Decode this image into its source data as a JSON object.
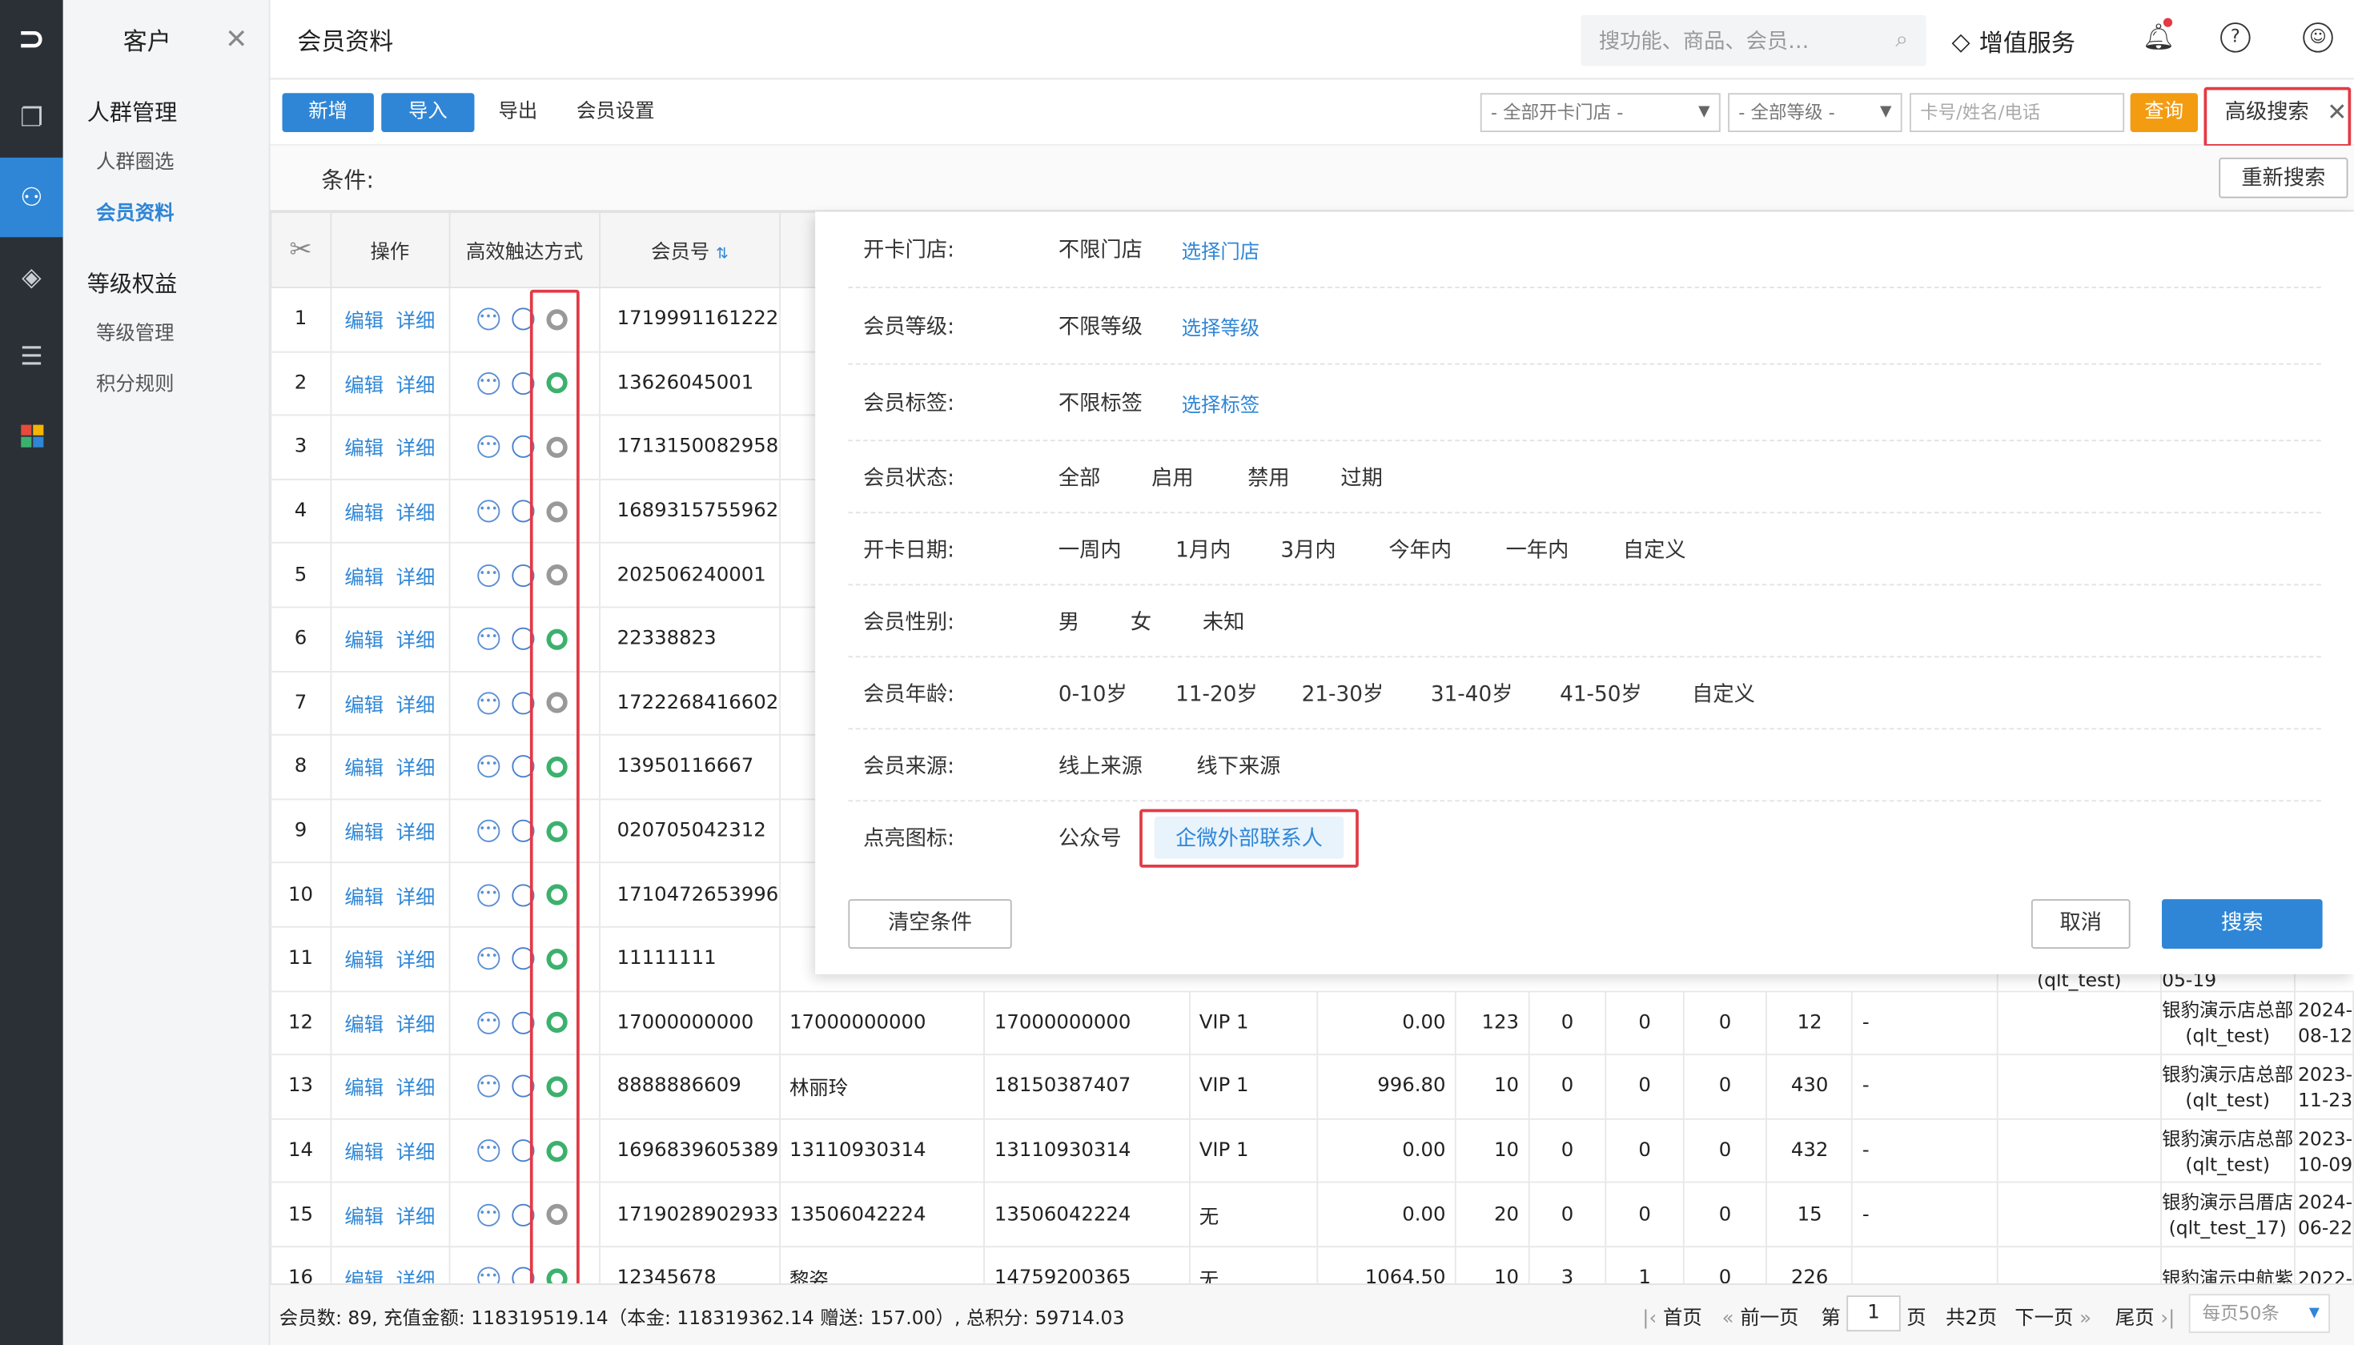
{
  "sidebar": {
    "module": "客户",
    "groups": [
      {
        "title": "人群管理",
        "items": [
          "人群圈选",
          "会员资料"
        ]
      },
      {
        "title": "等级权益",
        "items": [
          "等级管理",
          "积分规则"
        ]
      }
    ]
  },
  "header": {
    "title": "会员资料",
    "search_placeholder": "搜功能、商品、会员…",
    "value_service": "增值服务"
  },
  "toolbar": {
    "add": "新增",
    "import": "导入",
    "export": "导出",
    "settings": "会员设置",
    "store_select": "- 全部开卡门店 -",
    "level_select": "- 全部等级 -",
    "keyword_placeholder": "卡号/姓名/电话",
    "query": "查询",
    "advanced": "高级搜索"
  },
  "condition": {
    "label": "条件:",
    "reset": "重新搜索"
  },
  "table": {
    "headers": [
      "操作",
      "高效触达方式",
      "会员号"
    ],
    "edit": "编辑",
    "detail": "详细",
    "rows": [
      {
        "no": "1",
        "id": "1719991161222",
        "green": false
      },
      {
        "no": "2",
        "id": "13626045001",
        "green": true
      },
      {
        "no": "3",
        "id": "1713150082958",
        "green": false
      },
      {
        "no": "4",
        "id": "1689315755962",
        "green": false
      },
      {
        "no": "5",
        "id": "202506240001",
        "green": false
      },
      {
        "no": "6",
        "id": "22338823",
        "green": true
      },
      {
        "no": "7",
        "id": "1722268416602",
        "green": false
      },
      {
        "no": "8",
        "id": "13950116667",
        "green": true
      },
      {
        "no": "9",
        "id": "020705042312",
        "green": true
      },
      {
        "no": "10",
        "id": "1710472653996",
        "green": true
      },
      {
        "no": "11",
        "id": "11111111",
        "green": true
      },
      {
        "no": "12",
        "id": "17000000000",
        "green": true,
        "name": "17000000000",
        "phone": "17000000000",
        "level": "VIP 1",
        "amount": "0.00",
        "points": "123",
        "c1": "0",
        "c2": "0",
        "c3": "0",
        "visits": "12",
        "dash": "-",
        "store": "银豹演示店总部",
        "store2": "(qlt_test)",
        "date": "2024-",
        "date2": "08-12"
      },
      {
        "no": "13",
        "id": "8888886609",
        "green": true,
        "name": "林丽玲",
        "phone": "18150387407",
        "level": "VIP 1",
        "amount": "996.80",
        "points": "10",
        "c1": "0",
        "c2": "0",
        "c3": "0",
        "visits": "430",
        "dash": "-",
        "store": "银豹演示店总部",
        "store2": "(qlt_test)",
        "date": "2023-",
        "date2": "11-23"
      },
      {
        "no": "14",
        "id": "1696839605389",
        "green": true,
        "name": "13110930314",
        "phone": "13110930314",
        "level": "VIP 1",
        "amount": "0.00",
        "points": "10",
        "c1": "0",
        "c2": "0",
        "c3": "0",
        "visits": "432",
        "dash": "-",
        "store": "银豹演示店总部",
        "store2": "(qlt_test)",
        "date": "2023-",
        "date2": "10-09"
      },
      {
        "no": "15",
        "id": "1719028902933",
        "green": false,
        "name": "13506042224",
        "phone": "13506042224",
        "level": "无",
        "amount": "0.00",
        "points": "20",
        "c1": "0",
        "c2": "0",
        "c3": "0",
        "visits": "15",
        "dash": "-",
        "store": "银豹演示吕厝店",
        "store2": "(qlt_test_17)",
        "date": "2024-",
        "date2": "06-22"
      },
      {
        "no": "16",
        "id": "12345678",
        "green": true,
        "name": "黎姿",
        "phone": "14759200365",
        "level": "无",
        "amount": "1064.50",
        "points": "10",
        "c1": "3",
        "c2": "1",
        "c3": "0",
        "visits": "226",
        "dash": "",
        "store": "银豹演示中航紫",
        "store2": "",
        "date": "2022-",
        "date2": ""
      }
    ],
    "row11_store2": "(qlt_test)",
    "row11_date": "05-19"
  },
  "panel": {
    "store": {
      "label": "开卡门店:",
      "value": "不限门店",
      "link": "选择门店"
    },
    "level": {
      "label": "会员等级:",
      "value": "不限等级",
      "link": "选择等级"
    },
    "tag": {
      "label": "会员标签:",
      "value": "不限标签",
      "link": "选择标签"
    },
    "status": {
      "label": "会员状态:",
      "options": [
        "全部",
        "启用",
        "禁用",
        "过期"
      ]
    },
    "date": {
      "label": "开卡日期:",
      "options": [
        "一周内",
        "1月内",
        "3月内",
        "今年内",
        "一年内",
        "自定义"
      ]
    },
    "gender": {
      "label": "会员性别:",
      "options": [
        "男",
        "女",
        "未知"
      ]
    },
    "age": {
      "label": "会员年龄:",
      "options": [
        "0-10岁",
        "11-20岁",
        "21-30岁",
        "31-40岁",
        "41-50岁",
        "自定义"
      ]
    },
    "source": {
      "label": "会员来源:",
      "options": [
        "线上来源",
        "线下来源"
      ]
    },
    "icon": {
      "label": "点亮图标:",
      "options": [
        "公众号",
        "企微外部联系人"
      ]
    },
    "clear": "清空条件",
    "cancel": "取消",
    "search": "搜索"
  },
  "footer": {
    "summary": "会员数: 89, 充值金额: 118319519.14（本金: 118319362.14 赠送: 157.00）, 总积分: 59714.03",
    "first": "首页",
    "prev": "前一页",
    "page_label": "第",
    "page": "1",
    "page_unit": "页",
    "total": "共2页",
    "next": "下一页",
    "last": "尾页",
    "per_page": "每页50条"
  }
}
